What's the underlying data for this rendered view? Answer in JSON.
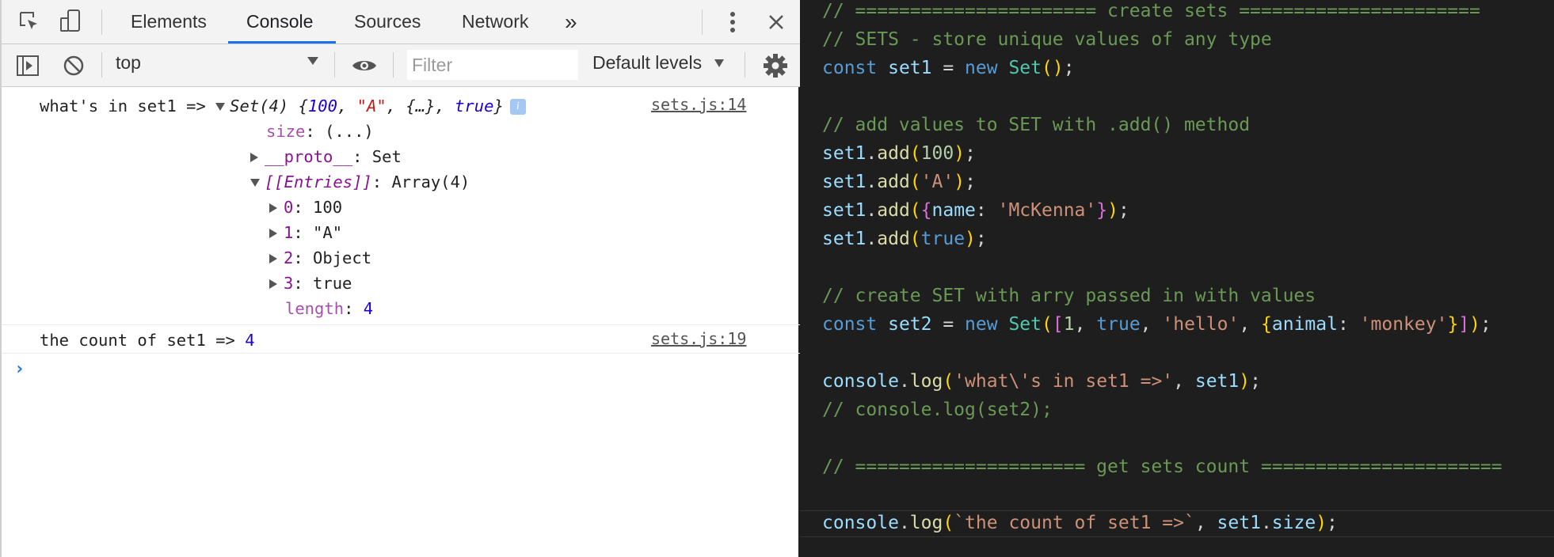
{
  "devtools": {
    "tabs": [
      "Elements",
      "Console",
      "Sources",
      "Network"
    ],
    "more_tabs": "»",
    "context": "top",
    "filter_placeholder": "Filter",
    "levels": "Default levels"
  },
  "console": {
    "log1": {
      "prefix": "what's in set1 =>",
      "set_label": "Set(4)",
      "set_open": "{",
      "v1": "100",
      "v2": "\"A\"",
      "v3": "{…}",
      "v4": "true",
      "set_close": "}",
      "source": "sets.js:14",
      "size_key": "size",
      "size_val": "(...)",
      "proto_key": "__proto__",
      "proto_val": "Set",
      "entries_key": "[[Entries]]",
      "entries_val": "Array(4)",
      "entries": [
        {
          "k": "0",
          "v": "100"
        },
        {
          "k": "1",
          "v": "\"A\""
        },
        {
          "k": "2",
          "v": "Object"
        },
        {
          "k": "3",
          "v": "true"
        }
      ],
      "length_key": "length",
      "length_val": "4"
    },
    "log2": {
      "text": "the count of set1 =>",
      "value": "4",
      "source": "sets.js:19"
    },
    "prompt": "›"
  },
  "editor": {
    "l1": "// ====================== create sets ======================",
    "l2": "// SETS - store unique values of any type",
    "l3": {
      "kw": "const",
      "name": "set1",
      "eq": " = ",
      "new": "new",
      "cls": "Set",
      "open": "(",
      "close": ")",
      "semi": ";"
    },
    "l4": "// add values to SET with .add() method",
    "adds": [
      {
        "obj": "set1",
        "dot": ".",
        "fn": "add",
        "arg": "100",
        "type": "num"
      },
      {
        "obj": "set1",
        "dot": ".",
        "fn": "add",
        "arg": "'A'",
        "type": "str"
      },
      {
        "obj": "set1",
        "dot": ".",
        "fn": "add",
        "type": "obj",
        "key": "name",
        "colon": ": ",
        "val": "'McKenna'"
      },
      {
        "obj": "set1",
        "dot": ".",
        "fn": "add",
        "arg": "true",
        "type": "kw"
      }
    ],
    "l9": "// create SET with arry passed in with values",
    "l10": {
      "kw": "const",
      "name": "set2",
      "eq": " = ",
      "new": "new",
      "cls": "Set",
      "n1": "1",
      "t": "true",
      "s": "'hello'",
      "key": "animal",
      "val": "'monkey'"
    },
    "l11": {
      "obj": "console",
      "fn": "log",
      "str": "'what\\'s in set1 =>'",
      "arg": "set1"
    },
    "l12": "// console.log(set2);",
    "l13": "// ===================== get sets count ======================",
    "l14": {
      "obj": "console",
      "fn": "log",
      "str": "`the count of set1 =>`",
      "arg": "set1",
      "prop": "size"
    }
  }
}
